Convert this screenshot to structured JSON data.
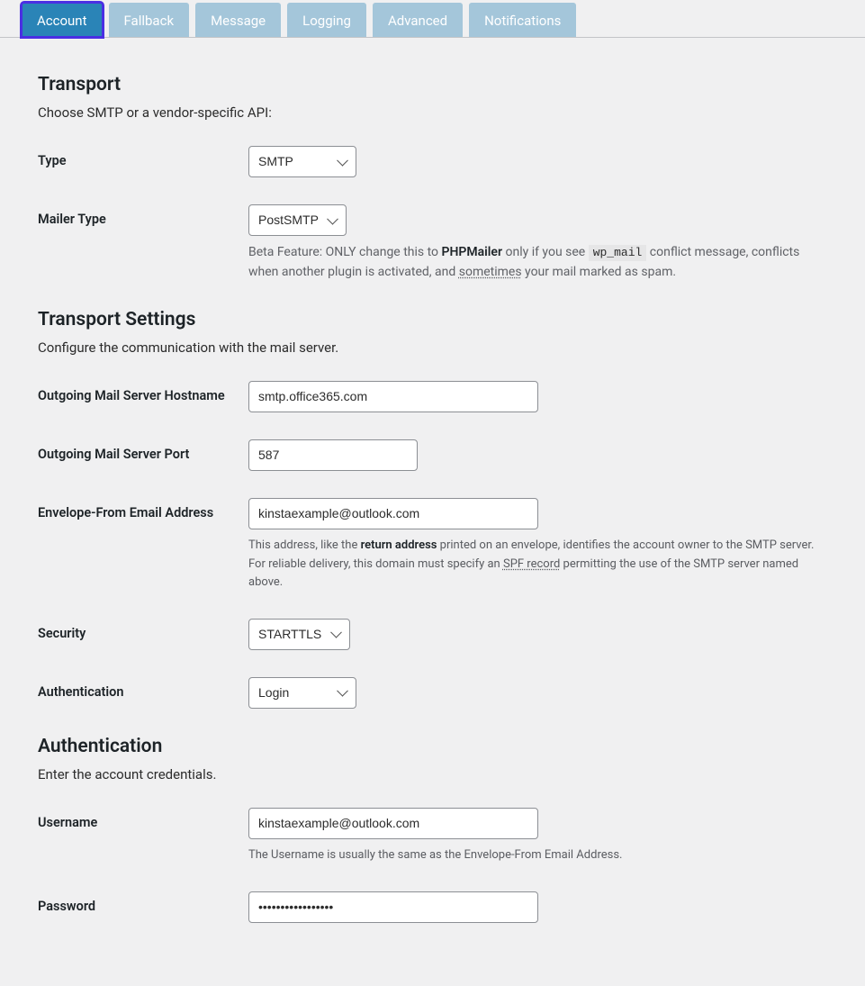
{
  "tabs": [
    {
      "label": "Account",
      "active": true
    },
    {
      "label": "Fallback",
      "active": false
    },
    {
      "label": "Message",
      "active": false
    },
    {
      "label": "Logging",
      "active": false
    },
    {
      "label": "Advanced",
      "active": false
    },
    {
      "label": "Notifications",
      "active": false
    }
  ],
  "transport": {
    "heading": "Transport",
    "desc": "Choose SMTP or a vendor-specific API:",
    "type_label": "Type",
    "type_value": "SMTP",
    "mailer_label": "Mailer Type",
    "mailer_value": "PostSMTP",
    "mailer_help_pre": "Beta Feature: ONLY change this to ",
    "mailer_help_bold": "PHPMailer",
    "mailer_help_mid": " only if you see ",
    "mailer_help_code": "wp_mail",
    "mailer_help_mid2": " conflict message, conflicts when another plugin is activated, and ",
    "mailer_help_uline": "sometimes",
    "mailer_help_post": " your mail marked as spam."
  },
  "settings": {
    "heading": "Transport Settings",
    "desc": "Configure the communication with the mail server.",
    "hostname_label": "Outgoing Mail Server Hostname",
    "hostname_value": "smtp.office365.com",
    "port_label": "Outgoing Mail Server Port",
    "port_value": "587",
    "envelope_label": "Envelope-From Email Address",
    "envelope_value": "kinstaexample@outlook.com",
    "envelope_help_pre": "This address, like the ",
    "envelope_help_bold": "return address",
    "envelope_help_mid": " printed on an envelope, identifies the account owner to the SMTP server. For reliable delivery, this domain must specify an ",
    "envelope_help_uline": "SPF record",
    "envelope_help_post": " permitting the use of the SMTP server named above.",
    "security_label": "Security",
    "security_value": "STARTTLS",
    "auth_label": "Authentication",
    "auth_value": "Login"
  },
  "auth": {
    "heading": "Authentication",
    "desc": "Enter the account credentials.",
    "username_label": "Username",
    "username_value": "kinstaexample@outlook.com",
    "username_help": "The Username is usually the same as the Envelope-From Email Address.",
    "password_label": "Password",
    "password_value": "•••••••••••••••••"
  }
}
